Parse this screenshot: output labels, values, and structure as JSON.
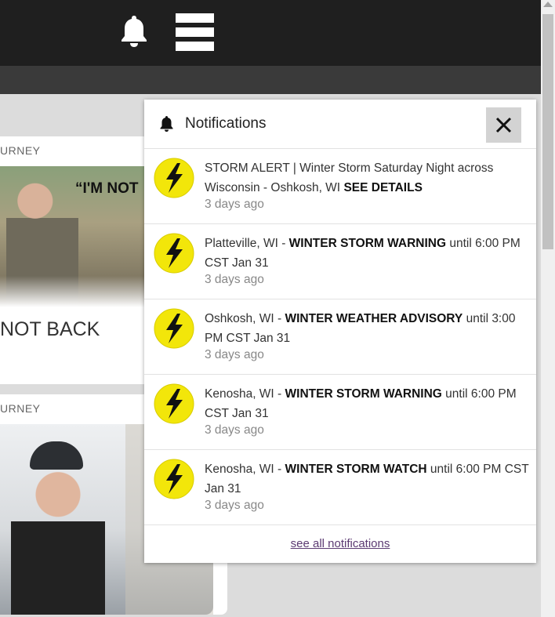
{
  "header": {
    "bell_icon": "bell-icon",
    "menu_icon": "hamburger-menu-icon"
  },
  "cards": [
    {
      "category": "URNEY",
      "image_text": "“I'M NOT",
      "title": "NOT BACK"
    },
    {
      "category": "URNEY"
    }
  ],
  "notifications": {
    "title": "Notifications",
    "close_label": "close",
    "items": [
      {
        "prefix": "STORM ALERT | Winter Storm Saturday Night across Wisconsin - Oshkosh, WI ",
        "bold": "SEE DETAILS",
        "suffix": "",
        "time": "3 days ago"
      },
      {
        "prefix": "Platteville, WI - ",
        "bold": "WINTER STORM WARNING",
        "suffix": " until 6:00 PM CST Jan 31",
        "time": "3 days ago"
      },
      {
        "prefix": "Oshkosh, WI - ",
        "bold": "WINTER WEATHER ADVISORY",
        "suffix": " until 3:00 PM CST Jan 31",
        "time": "3 days ago"
      },
      {
        "prefix": "Kenosha, WI - ",
        "bold": "WINTER STORM WARNING",
        "suffix": " until 6:00 PM CST Jan 31",
        "time": "3 days ago"
      },
      {
        "prefix": "Kenosha, WI - ",
        "bold": "WINTER STORM WATCH",
        "suffix": " until 6:00 PM CST Jan 31",
        "time": "3 days ago"
      }
    ],
    "see_all": "see all notifications"
  },
  "colors": {
    "topbar": "#1f1f1f",
    "icon_yellow": "#f2e60a",
    "link": "#5b3a72"
  }
}
